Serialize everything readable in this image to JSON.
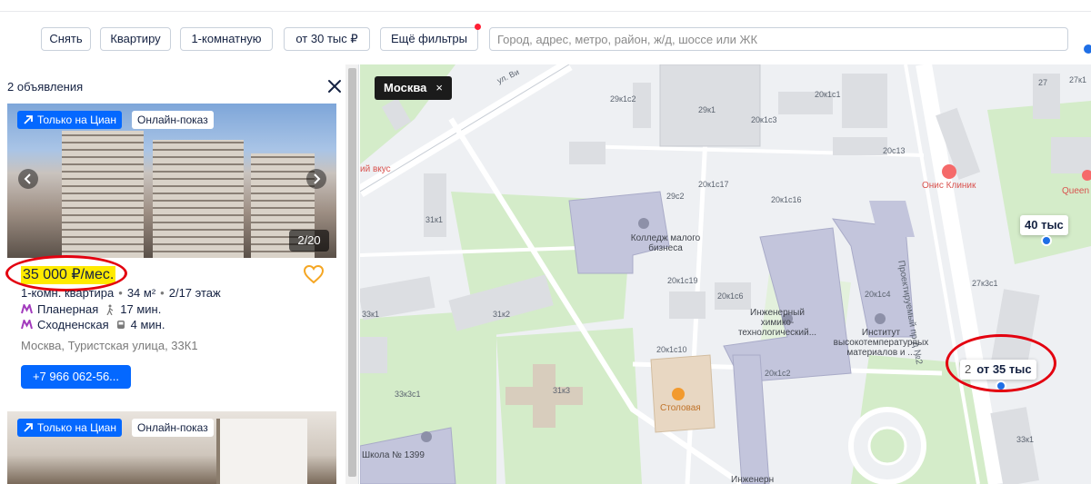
{
  "filters": {
    "deal": "Снять",
    "type": "Квартиру",
    "rooms": "1-комнатную",
    "price": "от 30 тыс ₽",
    "more": "Ещё фильтры",
    "search_placeholder": "Город, адрес, метро, район, ж/д, шоссе или ЖК"
  },
  "results": {
    "count": "2 объявления"
  },
  "listings": [
    {
      "badge_cian": "Только на Циан",
      "badge_show": "Онлайн-показ",
      "photo_counter": "2/20",
      "price": "35 000 ₽/мес.",
      "params": [
        "1-комн. квартира",
        "34 м²",
        "2/17 этаж"
      ],
      "metro": [
        {
          "name": "Планерная",
          "time": "17 мин."
        },
        {
          "name": "Сходненская",
          "time": "4 мин."
        }
      ],
      "address": "Москва, Туристская улица, 33К1",
      "phone": "+7 966 062-56..."
    },
    {
      "badge_cian": "Только на Циан",
      "badge_show": "Онлайн-показ"
    }
  ],
  "map": {
    "city_chip": "Москва",
    "close_glyph": "×",
    "street_top": "ул. Ви",
    "street_side": "Проектируемый пр-д №2",
    "poi": {
      "college": "Колледж малого бизнеса",
      "institute_chem": "Инженерный химико-технологический...",
      "institute_temp": "Институт высокотемпературных материалов и ...",
      "canteen": "Столовая",
      "school": "Школа № 1399",
      "clinic": "Онис Клиник",
      "cafe": "ий вкус",
      "queen": "Queen",
      "eng_bottom": "Инженерн"
    },
    "buildings": [
      "27к1",
      "27",
      "29к1с2",
      "29к1",
      "20к1с3",
      "20к1с1",
      "20с13",
      "29с2",
      "20к1с17",
      "20к1с16",
      "31к1",
      "20к1с19",
      "20к1с6",
      "20к1с4",
      "27к3с1",
      "31к2",
      "33к1",
      "20к1с10",
      "20к1с2",
      "31к3",
      "33к3с1",
      "33к1"
    ],
    "pins": [
      {
        "label": "40 тыс"
      },
      {
        "count": "2",
        "label": "от 35 тыс"
      }
    ]
  },
  "colors": {
    "brand": "#0468ff",
    "highlight": "#ffea00",
    "annotation": "#e3000f"
  }
}
